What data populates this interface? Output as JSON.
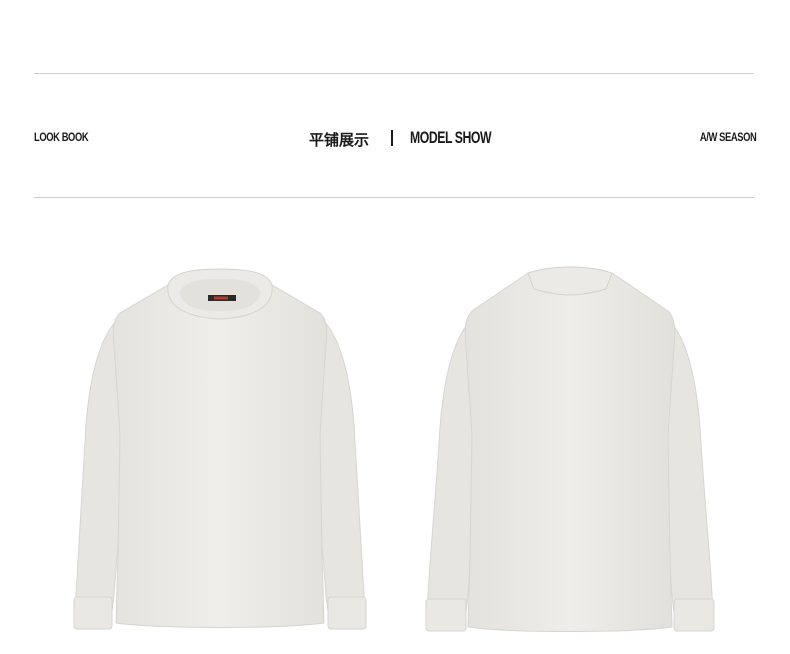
{
  "header": {
    "left_label": "LOOK BOOK",
    "center_cn": "平铺展示",
    "center_en": "MODEL SHOW",
    "right_label": "A/W SEASON"
  },
  "products": [
    {
      "view": "front",
      "color": "#ecebe7",
      "has_label": true
    },
    {
      "view": "back",
      "color": "#ecebe7",
      "has_label": false
    }
  ]
}
